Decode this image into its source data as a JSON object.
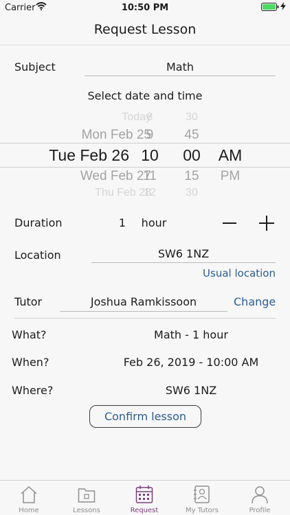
{
  "status_bar": {
    "carrier": "Carrier",
    "time": "10:50 PM"
  },
  "nav": {
    "title": "Request Lesson"
  },
  "subject": {
    "label": "Subject",
    "value": "Math"
  },
  "datetime": {
    "heading": "Select date and time",
    "days": [
      "Today",
      "Mon Feb 25",
      "Tue Feb 26",
      "Wed Feb 27",
      "Thu Feb 28"
    ],
    "hours": [
      "8",
      "9",
      "10",
      "11",
      "12"
    ],
    "minutes": [
      "30",
      "45",
      "00",
      "15",
      "30"
    ],
    "ampm": [
      "AM",
      "PM"
    ],
    "selected": {
      "day": "Tue Feb 26",
      "hour": "10",
      "minute": "00",
      "ampm": "AM"
    }
  },
  "duration": {
    "label": "Duration",
    "value": "1",
    "unit": "hour"
  },
  "location": {
    "label": "Location",
    "value": "SW6 1NZ",
    "usual_link": "Usual location"
  },
  "tutor": {
    "label": "Tutor",
    "value": "Joshua Ramkissoon",
    "change_link": "Change"
  },
  "summary": {
    "what_label": "What?",
    "what_value": "Math - 1 hour",
    "when_label": "When?",
    "when_value": "Feb 26, 2019 - 10:00 AM",
    "where_label": "Where?",
    "where_value": "SW6 1NZ"
  },
  "confirm": {
    "label": "Confirm lesson"
  },
  "tabs": [
    {
      "label": "Home",
      "icon": "home-icon"
    },
    {
      "label": "Lessons",
      "icon": "folder-icon"
    },
    {
      "label": "Request",
      "icon": "calendar-icon",
      "active": true
    },
    {
      "label": "My Tutors",
      "icon": "tutors-icon"
    },
    {
      "label": "Profile",
      "icon": "person-icon"
    }
  ],
  "colors": {
    "accent": "#2b5d91",
    "active_tab": "#7b3f7d",
    "battery": "#4cd964"
  }
}
